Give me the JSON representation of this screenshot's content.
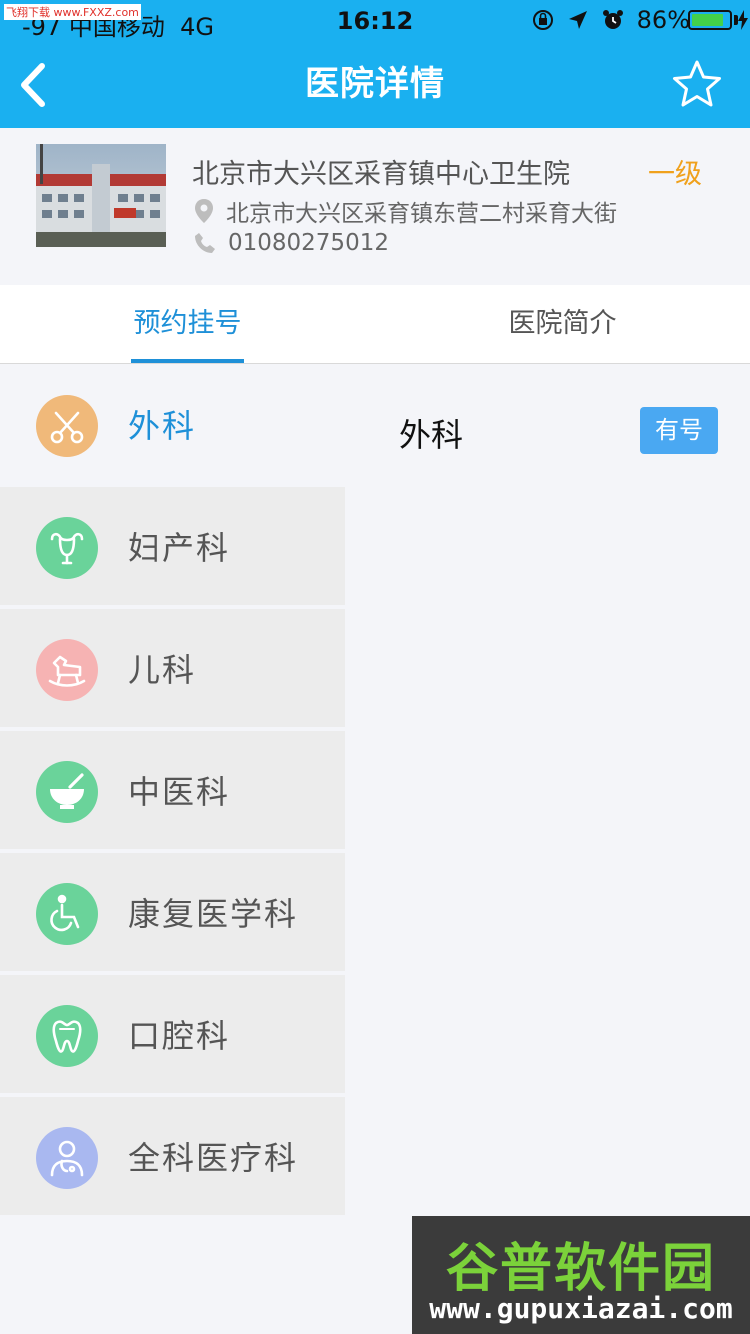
{
  "status_bar": {
    "carrier": "-97 中国移动",
    "network": "4G",
    "time": "16:12",
    "battery": "86%",
    "battery_level": 0.86,
    "icons": [
      "orientation-lock-icon",
      "location-arrow-icon",
      "alarm-clock-icon",
      "battery-icon",
      "charging-bolt-icon"
    ]
  },
  "watermark_top": "飞翔下载 www.FXXZ.com",
  "nav": {
    "title": "医院详情",
    "back_icon": "chevron-left-icon",
    "favorite_icon": "star-outline-icon"
  },
  "hospital": {
    "name": "北京市大兴区采育镇中心卫生院",
    "level": "一级",
    "address": "北京市大兴区采育镇东营二村采育大街",
    "phone": "01080275012"
  },
  "tabs": [
    {
      "label": "预约挂号",
      "active": true
    },
    {
      "label": "医院简介",
      "active": false
    }
  ],
  "departments": [
    {
      "label": "外科",
      "icon": "scissors-icon",
      "color": "#f0b97a",
      "active": true
    },
    {
      "label": "妇产科",
      "icon": "uterus-icon",
      "color": "#6ad39a",
      "active": false
    },
    {
      "label": "儿科",
      "icon": "rocking-horse-icon",
      "color": "#f6b3b3",
      "active": false
    },
    {
      "label": "中医科",
      "icon": "mortar-bowl-icon",
      "color": "#6ad39a",
      "active": false
    },
    {
      "label": "康复医学科",
      "icon": "wheelchair-icon",
      "color": "#6ad39a",
      "active": false
    },
    {
      "label": "口腔科",
      "icon": "tooth-icon",
      "color": "#6ad39a",
      "active": false
    },
    {
      "label": "全科医疗科",
      "icon": "doctor-icon",
      "color": "#a9b8f0",
      "active": false
    }
  ],
  "detail": {
    "title": "外科",
    "availability": "有号"
  },
  "watermark_bottom": {
    "brand": "谷普软件园",
    "url": "www.gupuxiazai.com"
  },
  "colors": {
    "nav_bg": "#1ab0f0",
    "accent": "#1e90d8",
    "level": "#f0a11c",
    "available_button": "#4aa8f2"
  }
}
